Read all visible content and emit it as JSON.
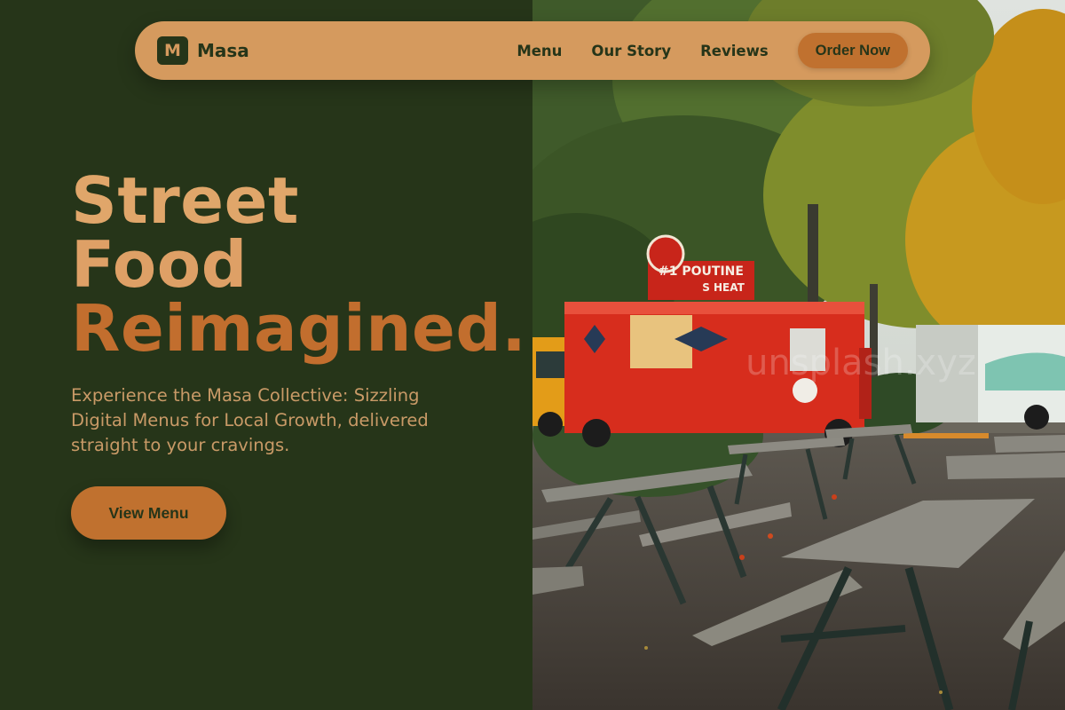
{
  "brand": {
    "logo_letter": "M",
    "name": "Masa"
  },
  "nav": {
    "links": [
      "Menu",
      "Our Story",
      "Reviews"
    ],
    "cta": "Order Now"
  },
  "hero": {
    "title_lines": [
      "Street",
      "Food",
      "Reimagined."
    ],
    "description": "Experience the Masa Collective: Sizzling Digital Menus for Local Growth, delivered straight to your cravings.",
    "button": "View Menu"
  },
  "photo": {
    "truck_signs": [
      "#1 POUTINE",
      "S HEAT"
    ],
    "watermark": "unsplash.xyz"
  },
  "colors": {
    "background": "#263519",
    "nav_background": "#d59a5e",
    "accent": "#c0712f",
    "title_light": "#e0a66a",
    "body_text": "#c99a67"
  }
}
